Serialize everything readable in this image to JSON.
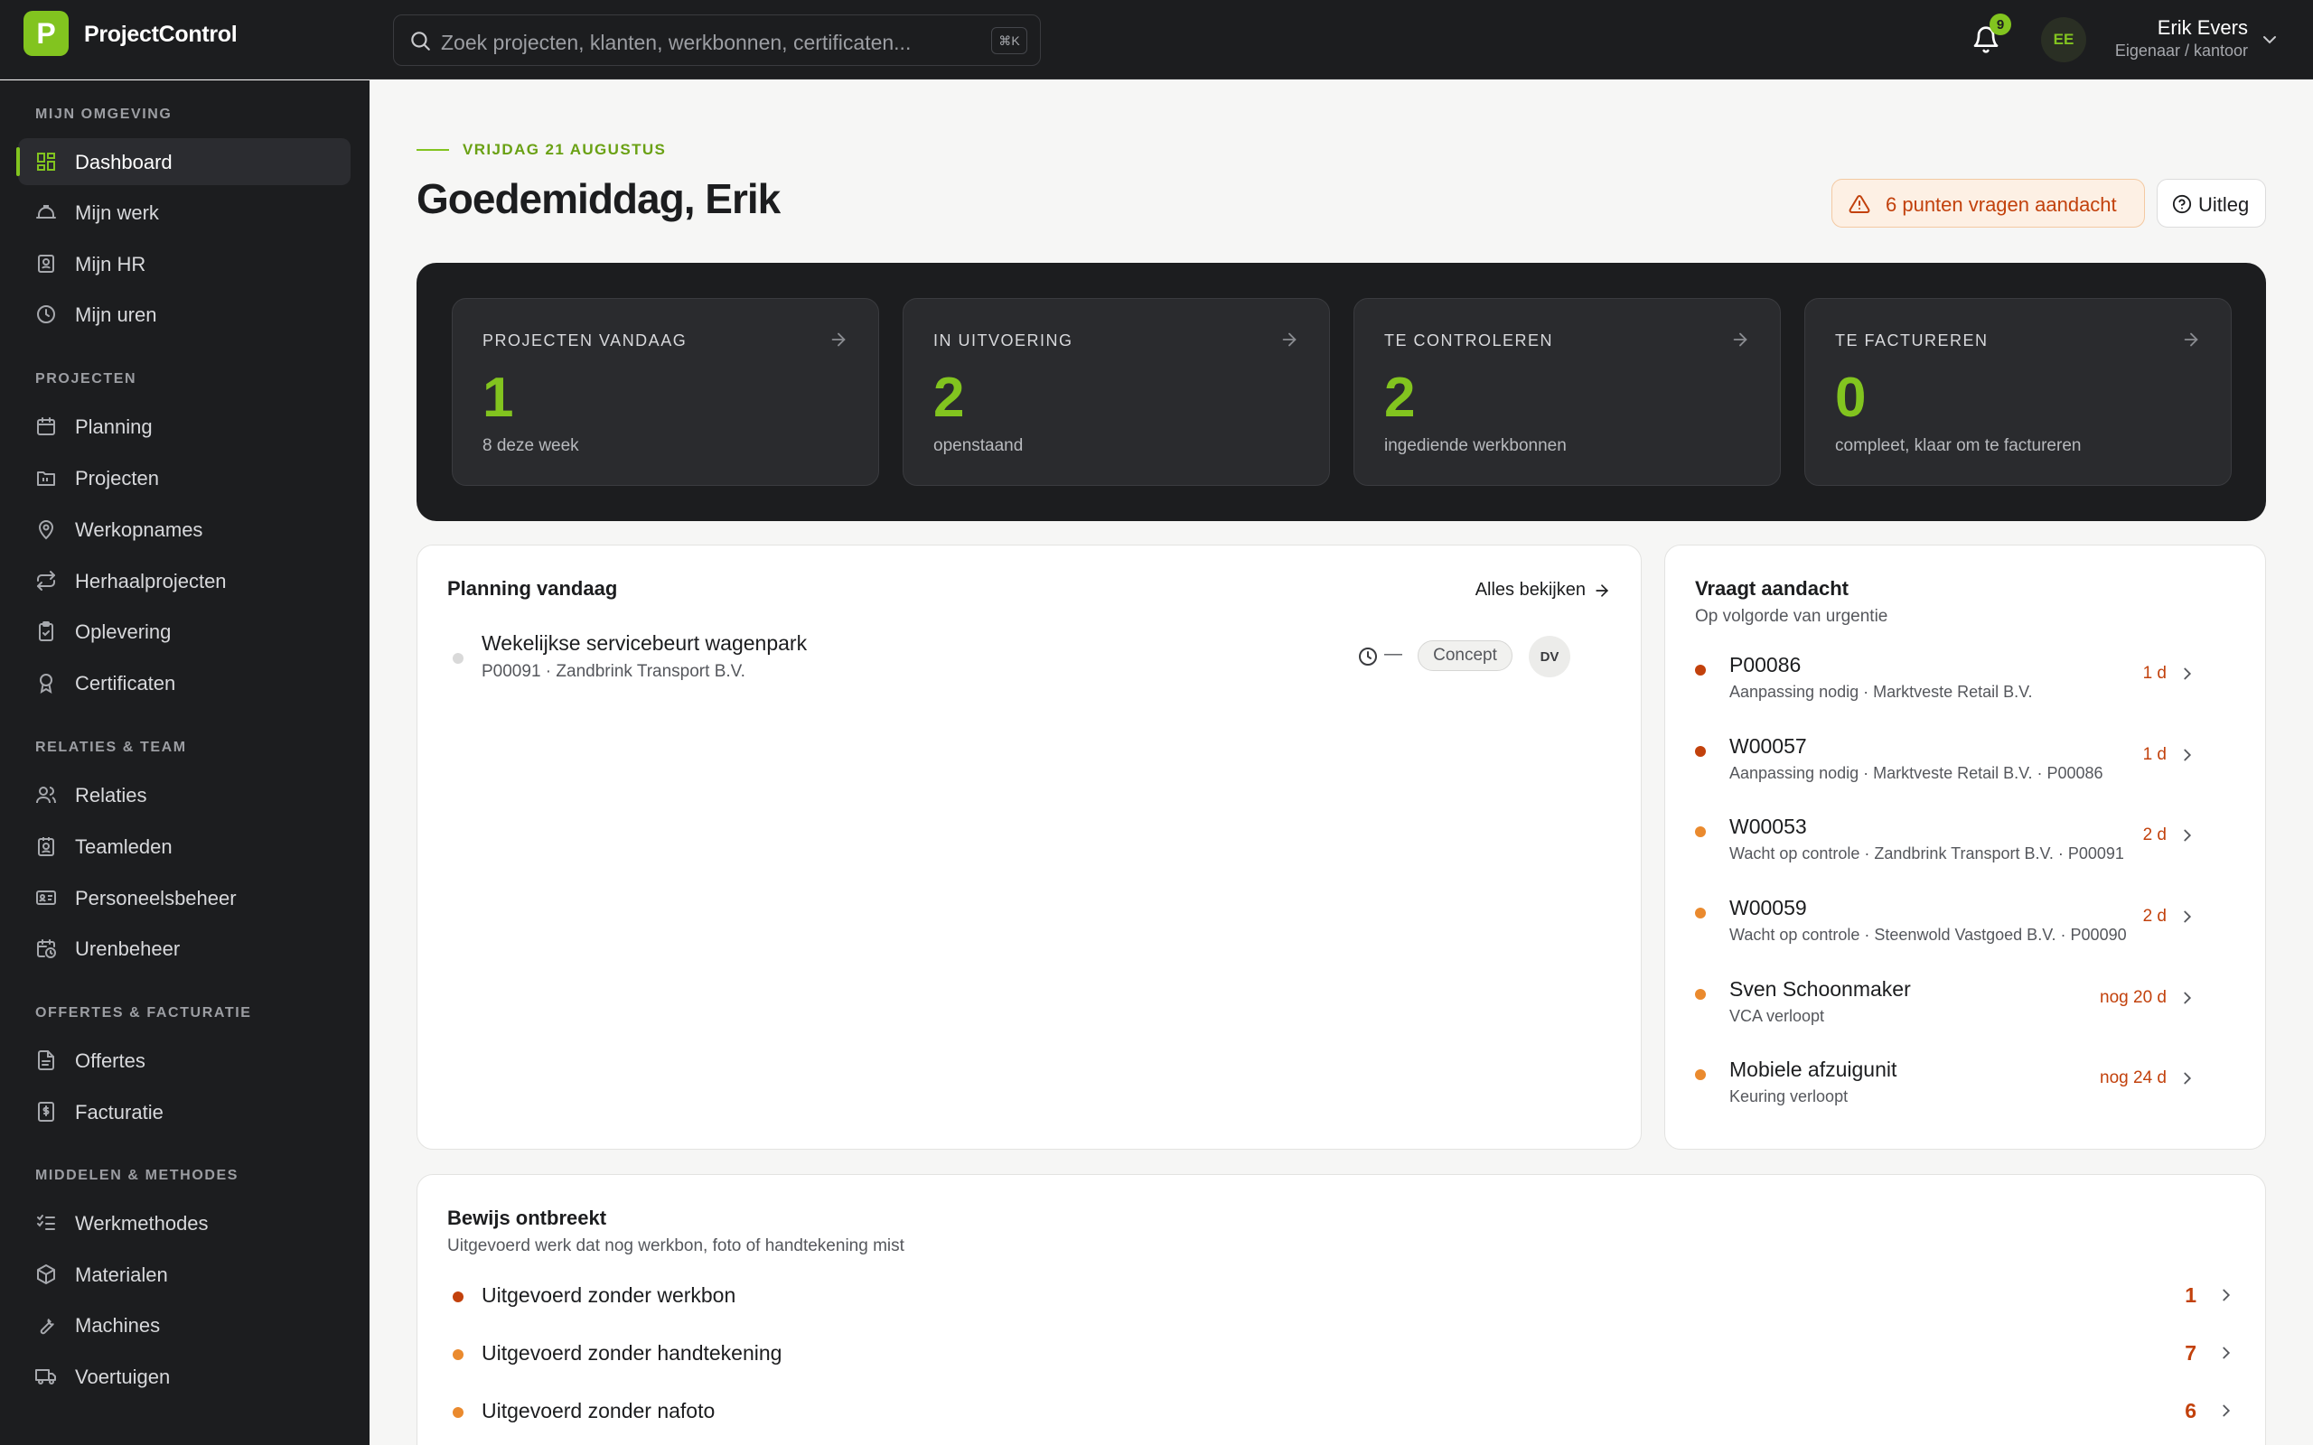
{
  "app": {
    "logo_letter": "P",
    "name": "ProjectControl"
  },
  "search": {
    "placeholder": "Zoek projecten, klanten, werkbonnen, certificaten...",
    "shortcut": "⌘K"
  },
  "notifications": {
    "count": "9"
  },
  "user": {
    "initials": "EE",
    "name": "Erik Evers",
    "role": "Eigenaar / kantoor"
  },
  "sidebar": {
    "sections": [
      {
        "title": "MIJN OMGEVING",
        "items": [
          {
            "label": "Dashboard",
            "icon": "dashboard-icon",
            "active": true
          },
          {
            "label": "Mijn werk",
            "icon": "hardhat-icon"
          },
          {
            "label": "Mijn HR",
            "icon": "badge-icon"
          },
          {
            "label": "Mijn uren",
            "icon": "clock-icon"
          }
        ]
      },
      {
        "title": "PROJECTEN",
        "items": [
          {
            "label": "Planning",
            "icon": "calendar-icon"
          },
          {
            "label": "Projecten",
            "icon": "folder-icon"
          },
          {
            "label": "Werkopnames",
            "icon": "map-pin-icon"
          },
          {
            "label": "Herhaalprojecten",
            "icon": "repeat-icon"
          },
          {
            "label": "Oplevering",
            "icon": "clipboard-check-icon"
          },
          {
            "label": "Certificaten",
            "icon": "award-icon"
          }
        ]
      },
      {
        "title": "RELATIES & TEAM",
        "items": [
          {
            "label": "Relaties",
            "icon": "users-icon"
          },
          {
            "label": "Teamleden",
            "icon": "contact-icon"
          },
          {
            "label": "Personeelsbeheer",
            "icon": "id-card-icon"
          },
          {
            "label": "Urenbeheer",
            "icon": "calendar-clock-icon"
          }
        ]
      },
      {
        "title": "OFFERTES & FACTURATIE",
        "items": [
          {
            "label": "Offertes",
            "icon": "file-text-icon"
          },
          {
            "label": "Facturatie",
            "icon": "receipt-icon"
          }
        ]
      },
      {
        "title": "MIDDELEN & METHODES",
        "items": [
          {
            "label": "Werkmethodes",
            "icon": "list-checks-icon"
          },
          {
            "label": "Materialen",
            "icon": "package-icon"
          },
          {
            "label": "Machines",
            "icon": "wrench-icon"
          },
          {
            "label": "Voertuigen",
            "icon": "truck-icon"
          }
        ]
      }
    ]
  },
  "header": {
    "date": "VRIJDAG 21 AUGUSTUS",
    "greeting": "Goedemiddag, Erik",
    "attention_label": "6 punten vragen aandacht",
    "help_label": "Uitleg"
  },
  "kpis": [
    {
      "title": "PROJECTEN VANDAAG",
      "value": "1",
      "sub": "8 deze week"
    },
    {
      "title": "IN UITVOERING",
      "value": "2",
      "sub": "openstaand"
    },
    {
      "title": "TE CONTROLEREN",
      "value": "2",
      "sub": "ingediende werkbonnen"
    },
    {
      "title": "TE FACTUREREN",
      "value": "0",
      "sub": "compleet, klaar om te factureren"
    }
  ],
  "planning": {
    "title": "Planning vandaag",
    "see_all": "Alles bekijken",
    "rows": [
      {
        "title": "Wekelijkse servicebeurt wagenpark",
        "meta": "P00091  ·  Zandbrink Transport B.V.",
        "time": "—",
        "status": "Concept",
        "assignee": "DV"
      }
    ]
  },
  "attention": {
    "title": "Vraagt aandacht",
    "subtitle": "Op volgorde van urgentie",
    "rows": [
      {
        "title": "P00086",
        "meta": "Aanpassing nodig · Marktveste Retail B.V.",
        "age": "1 d",
        "color": "#c2410c"
      },
      {
        "title": "W00057",
        "meta": "Aanpassing nodig · Marktveste Retail B.V. · P00086",
        "age": "1 d",
        "color": "#c2410c"
      },
      {
        "title": "W00053",
        "meta": "Wacht op controle · Zandbrink Transport B.V. · P00091",
        "age": "2 d",
        "color": "#ea8a2e"
      },
      {
        "title": "W00059",
        "meta": "Wacht op controle · Steenwold Vastgoed B.V. · P00090",
        "age": "2 d",
        "color": "#ea8a2e"
      },
      {
        "title": "Sven Schoonmaker",
        "meta": "VCA verloopt",
        "age": "nog 20 d",
        "color": "#ea8a2e"
      },
      {
        "title": "Mobiele afzuigunit",
        "meta": "Keuring verloopt",
        "age": "nog 24 d",
        "color": "#ea8a2e"
      }
    ]
  },
  "evidence": {
    "title": "Bewijs ontbreekt",
    "subtitle": "Uitgevoerd werk dat nog werkbon, foto of handtekening mist",
    "rows": [
      {
        "title": "Uitgevoerd zonder werkbon",
        "count": "1",
        "color": "#c2410c"
      },
      {
        "title": "Uitgevoerd zonder handtekening",
        "count": "7",
        "color": "#ea8a2e"
      },
      {
        "title": "Uitgevoerd zonder nafoto",
        "count": "6",
        "color": "#ea8a2e"
      }
    ]
  },
  "colors": {
    "accent": "#82c41f",
    "dark": "#1c1d1f",
    "warning": "#c2410c",
    "caution": "#ea8a2e"
  }
}
